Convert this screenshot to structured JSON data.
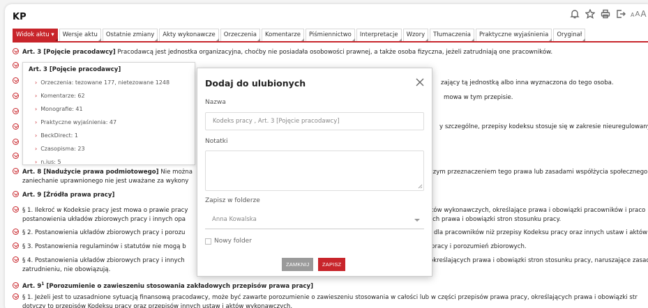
{
  "doc_title": "KP",
  "toolbar": {
    "icons": [
      "bell-icon",
      "star-icon",
      "print-icon",
      "export-icon"
    ],
    "font_size": [
      "A",
      "A",
      "A"
    ]
  },
  "tabs": [
    {
      "label": "Widok aktu ▾",
      "active": true
    },
    {
      "label": "Wersje aktu"
    },
    {
      "label": "Ostatnie zmiany"
    },
    {
      "label": "Akty wykonawcze"
    },
    {
      "label": "Orzeczenia"
    },
    {
      "label": "Komentarze"
    },
    {
      "label": "Piśmiennictwo"
    },
    {
      "label": "Interpretacje"
    },
    {
      "label": "Wzory"
    },
    {
      "label": "Tłumaczenia"
    },
    {
      "label": "Praktyczne wyjaśnienia"
    },
    {
      "label": "Oryginał"
    }
  ],
  "colors": {
    "accent": "#c8252b"
  },
  "content": {
    "art3": {
      "heading": "Art. 3 [Pojęcie pracodawcy]",
      "text": " Pracodawcą jest jednostka organizacyjna, choćby nie posiadała osobowości prawnej, a także osoba fizyczna, jeżeli zatrudniają one pracowników."
    },
    "r_line2": "zający tą jednostką albo inna wyznaczona do tego osoba.",
    "r_line3": "mowa w tym przepisie.",
    "r_line4": "y szczególne, przepisy kodeksu stosuje się w zakresie nieuregulowany",
    "art8": {
      "heading": "Art. 8 [Nadużycie prawa podmiotowego]",
      "text_left": " Nie można",
      "text_right": "czym przeznaczeniem tego prawa lub zasadami współżycia społecznego",
      "text_line2": "zaniechanie uprawnionego nie jest uważane za wykony"
    },
    "art9": {
      "heading": "Art. 9 [Źródła prawa pracy]"
    },
    "art9_p1": {
      "left": "§ 1. Ilekroć w Kodeksie pracy jest mowa o prawie pracy",
      "right": "któw wykonawczych, określające prawa i obowiązki pracowników i praco",
      "line2_left": "postanowienia układów zbiorowych pracy i innych opa",
      "line2_right": "ych prawa i obowiązki stron stosunku pracy."
    },
    "art9_p2": {
      "left": "§ 2. Postanowienia układów zbiorowych pracy i porozu",
      "right": "dla pracowników niż przepisy Kodeksu pracy oraz innych ustaw i aktów"
    },
    "art9_p3": {
      "left": "§ 3. Postanowienia regulaminów i statutów nie mogą b",
      "right": "pracy i porozumień zbiorowych."
    },
    "art9_p4": {
      "left": "§ 4. Postanowienia układów zbiorowych pracy i innych",
      "right": "określających prawa i obowiązki stron stosunku pracy, naruszające zasadę",
      "line2": "zatrudnieniu, nie obowiązują."
    },
    "art9_1": {
      "heading_a": "Art. 9",
      "heading_sup": "1",
      "heading_b": " [Porozumienie o zawieszeniu stosowania zakładowych przepisów prawa pracy]"
    },
    "art9_1_p1": {
      "line1": "§ 1. Jeżeli jest to uzasadnione sytuacją finansową pracodawcy, może być zawarte porozumienie o zawieszeniu stosowania w całości lub w części przepisów prawa pracy, określających prawa i obowiązki str",
      "line2": "dotyczy to przepisów Kodeksu pracy oraz przepisów innych ustaw i aktów wykonawczych."
    }
  },
  "popover": {
    "title": "Art. 3 [Pojęcie pracodawcy]",
    "items": [
      "Orzeczenia: tezowane 177, nietezowane 1248",
      "Komentarze: 62",
      "Monografie: 41",
      "Praktyczne wyjaśnienia: 47",
      "BeckDirect: 1",
      "Czasopisma: 23",
      "n.ius: 5"
    ]
  },
  "modal": {
    "title": "Dodaj do ulubionych",
    "name_label": "Nazwa",
    "name_value": "Kodeks pracy , Art. 3 [Pojęcie pracodawcy]",
    "notes_label": "Notatki",
    "folder_label": "Zapisz w folderze",
    "folder_value": "Anna Kowalska",
    "new_folder_label": "Nowy folder",
    "close_label": "ZAMKNIJ",
    "save_label": "ZAPISZ"
  }
}
